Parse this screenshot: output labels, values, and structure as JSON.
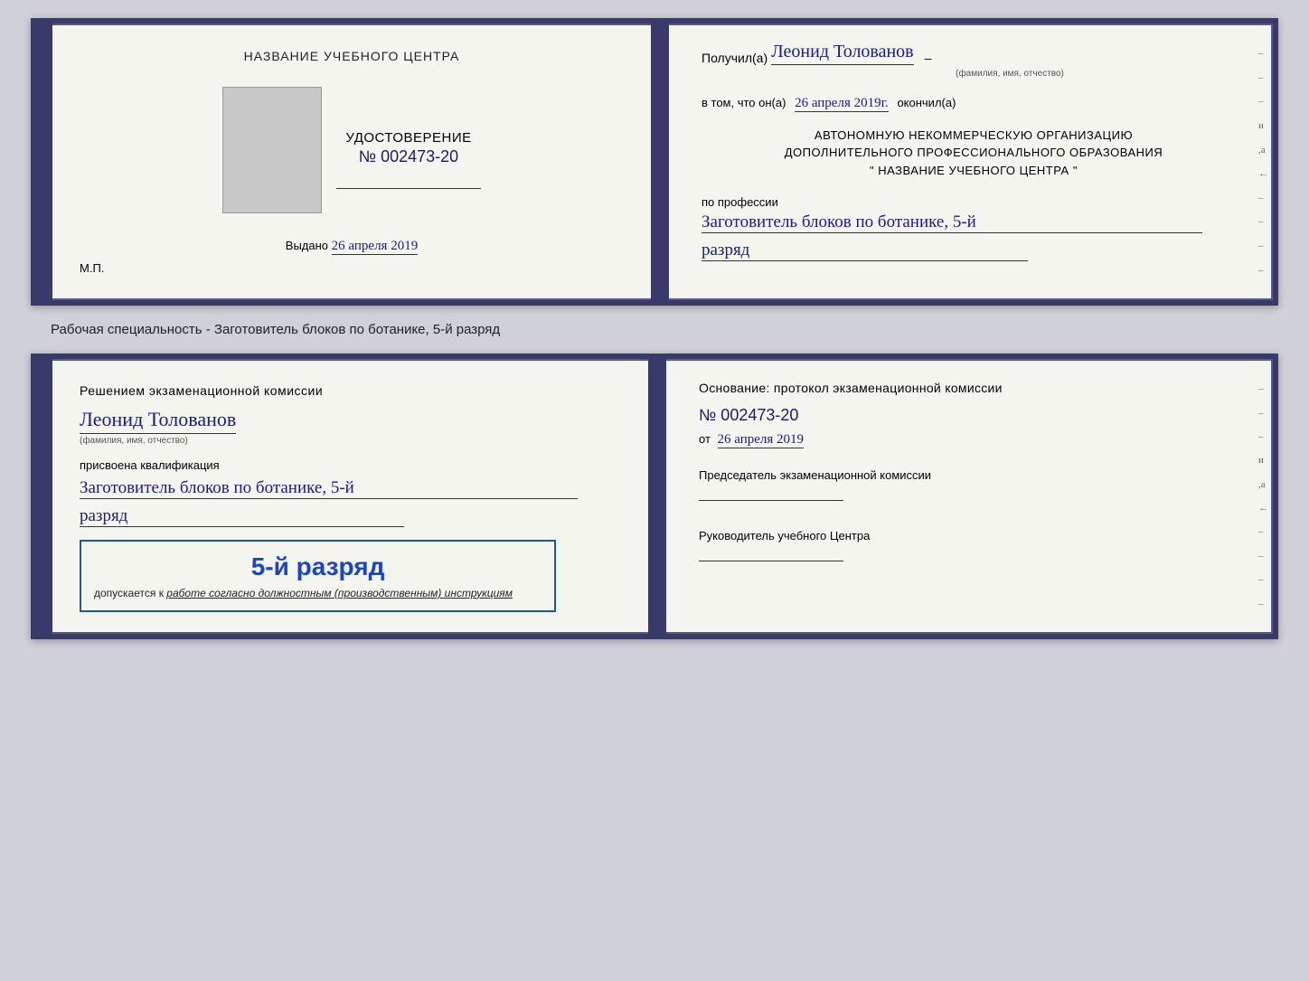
{
  "doc1": {
    "left": {
      "heading": "НАЗВАНИЕ УЧЕБНОГО ЦЕНТРА",
      "cert_title": "УДОСТОВЕРЕНИЕ",
      "cert_number": "№ 002473-20",
      "issued_label": "Выдано",
      "issued_date": "26 апреля 2019",
      "mp_label": "М.П."
    },
    "right": {
      "received_prefix": "Получил(а)",
      "recipient_name": "Леонид Толованов",
      "recipient_sublabel": "(фамилия, имя, отчество)",
      "confirm_prefix": "в том, что он(а)",
      "confirm_date": "26 апреля 2019г.",
      "confirm_suffix": "окончил(а)",
      "org_line1": "АВТОНОМНУЮ НЕКОММЕРЧЕСКУЮ ОРГАНИЗАЦИЮ",
      "org_line2": "ДОПОЛНИТЕЛЬНОГО ПРОФЕССИОНАЛЬНОГО ОБРАЗОВАНИЯ",
      "org_line3": "\"  НАЗВАНИЕ УЧЕБНОГО ЦЕНТРА  \"",
      "profession_label": "по профессии",
      "profession_value": "Заготовитель блоков по ботанике, 5-й",
      "rank_value": "разряд",
      "side_marks": [
        "-",
        "-",
        "-",
        "и",
        ",а",
        "←",
        "-",
        "-",
        "-",
        "-"
      ]
    }
  },
  "specialty_label": "Рабочая специальность - Заготовитель блоков по ботанике, 5-й разряд",
  "doc2": {
    "left": {
      "commission_heading": "Решением экзаменационной комиссии",
      "person_name": "Леонид Толованов",
      "person_sublabel": "(фамилия, имя, отчество)",
      "qualification_label": "присвоена квалификация",
      "qualification_value": "Заготовитель блоков по ботанике, 5-й",
      "rank_value": "разряд",
      "stamp_rank": "5-й разряд",
      "stamp_prefix": "допускается к",
      "stamp_italic": "работе согласно должностным (производственным) инструкциям"
    },
    "right": {
      "basis_heading": "Основание: протокол экзаменационной комиссии",
      "number": "№  002473-20",
      "from_prefix": "от",
      "from_date": "26 апреля 2019",
      "commission_chair_label": "Председатель экзаменационной комиссии",
      "center_head_label": "Руководитель учебного Центра",
      "side_marks": [
        "-",
        "-",
        "-",
        "и",
        ",а",
        "←",
        "-",
        "-",
        "-",
        "-"
      ]
    }
  }
}
